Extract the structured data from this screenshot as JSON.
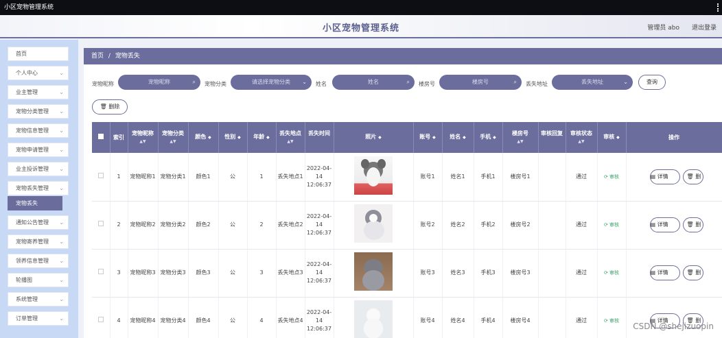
{
  "window": {
    "title": "小区宠物管理系统"
  },
  "header": {
    "title": "小区宠物管理系统",
    "admin": "管理员 abo",
    "logout": "退出登录"
  },
  "sidebar": {
    "items": [
      {
        "label": "首页",
        "chevron": false
      },
      {
        "label": "个人中心",
        "chevron": true
      },
      {
        "label": "业主管理",
        "chevron": true
      },
      {
        "label": "宠物分类管理",
        "chevron": true
      },
      {
        "label": "宠物信息管理",
        "chevron": true
      },
      {
        "label": "宠物申请管理",
        "chevron": true
      },
      {
        "label": "业主投诉管理",
        "chevron": true
      },
      {
        "label": "宠物丢失管理",
        "chevron": true
      },
      {
        "label": "宠物丢失",
        "chevron": false,
        "active": true
      },
      {
        "label": "通知公告管理",
        "chevron": true
      },
      {
        "label": "宠物寄养管理",
        "chevron": true
      },
      {
        "label": "领养信息管理",
        "chevron": true
      },
      {
        "label": "轮播图",
        "chevron": true
      },
      {
        "label": "系统管理",
        "chevron": true
      },
      {
        "label": "订单管理",
        "chevron": true
      }
    ]
  },
  "breadcrumb": {
    "home": "首页",
    "sep": "/",
    "current": "宠物丢失"
  },
  "filters": {
    "nickname": {
      "label": "宠物昵称",
      "placeholder": "宠物昵称"
    },
    "category": {
      "label": "宠物分类",
      "placeholder": "请选择宠物分类"
    },
    "name": {
      "label": "姓名",
      "placeholder": "姓名"
    },
    "room": {
      "label": "楼房号",
      "placeholder": "楼房号"
    },
    "location": {
      "label": "丢失地址",
      "placeholder": "丢失地址"
    },
    "search_label": "查询"
  },
  "actions": {
    "delete_label": "删除"
  },
  "table": {
    "columns": [
      "索引",
      "宠物昵称",
      "宠物分类",
      "颜色",
      "性别",
      "年龄",
      "丢失地点",
      "丢失时间",
      "照片",
      "账号",
      "姓名",
      "手机",
      "楼房号",
      "审核回复",
      "审核状态",
      "审核",
      "操作"
    ],
    "rows": [
      {
        "index": "1",
        "nickname": "宠物昵称1",
        "category": "宠物分类1",
        "color": "颜色1",
        "gender": "公",
        "age": "1",
        "place": "丢失地点1",
        "time": "2022-04-14 12:06:37",
        "account": "账号1",
        "name": "姓名1",
        "phone": "手机1",
        "room": "楼房号1",
        "reply": "",
        "status": "通过",
        "audit": "审核",
        "detail": "详情",
        "del": "删"
      },
      {
        "index": "2",
        "nickname": "宠物昵称2",
        "category": "宠物分类2",
        "color": "颜色2",
        "gender": "公",
        "age": "2",
        "place": "丢失地点2",
        "time": "2022-04-14 12:06:37",
        "account": "账号2",
        "name": "姓名2",
        "phone": "手机2",
        "room": "楼房号2",
        "reply": "",
        "status": "通过",
        "audit": "审核",
        "detail": "详情",
        "del": "删"
      },
      {
        "index": "3",
        "nickname": "宠物昵称3",
        "category": "宠物分类3",
        "color": "颜色3",
        "gender": "公",
        "age": "3",
        "place": "丢失地点3",
        "time": "2022-04-14 12:06:37",
        "account": "账号3",
        "name": "姓名3",
        "phone": "手机3",
        "room": "楼房号3",
        "reply": "",
        "status": "通过",
        "audit": "审核",
        "detail": "详情",
        "del": "删"
      },
      {
        "index": "4",
        "nickname": "宠物昵称4",
        "category": "宠物分类4",
        "color": "颜色4",
        "gender": "公",
        "age": "4",
        "place": "丢失地点4",
        "time": "2022-04-14 12:06:37",
        "account": "账号4",
        "name": "姓名4",
        "phone": "手机4",
        "room": "楼房号4",
        "reply": "",
        "status": "通过",
        "audit": "审核",
        "detail": "详情",
        "del": "删"
      }
    ]
  },
  "watermark": "CSDN @shejizuopin",
  "colors": {
    "accent": "#6b6e9c",
    "sidebar_bg": "#c7d9f5",
    "audit_green": "#3aa36b"
  }
}
